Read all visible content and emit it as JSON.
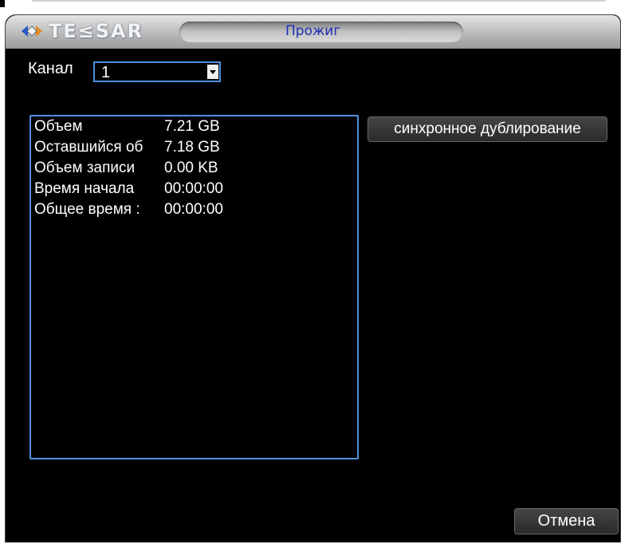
{
  "window": {
    "brand": "TE≤SAR",
    "title": "Прожиг"
  },
  "channel": {
    "label": "Канал",
    "value": "1"
  },
  "info": {
    "rows": [
      {
        "label": "Объем",
        "value": "7.21 GB"
      },
      {
        "label": "Оставшийся об",
        "value": "7.18 GB"
      },
      {
        "label": "Объем записи",
        "value": "0.00 KB"
      },
      {
        "label": "Время начала",
        "value": "00:00:00"
      },
      {
        "label": "Общее время :",
        "value": "00:00:00"
      }
    ]
  },
  "buttons": {
    "sync_label": "синхронное дублирование",
    "cancel_label": "Отмена"
  },
  "colors": {
    "accent_border": "#4f8fe0",
    "title_text": "#1e2fb5",
    "background": "#000000",
    "text": "#ffffff"
  },
  "icons": {
    "logo_mark": "diamond-arrows-icon",
    "dropdown": "chevron-down-icon"
  }
}
